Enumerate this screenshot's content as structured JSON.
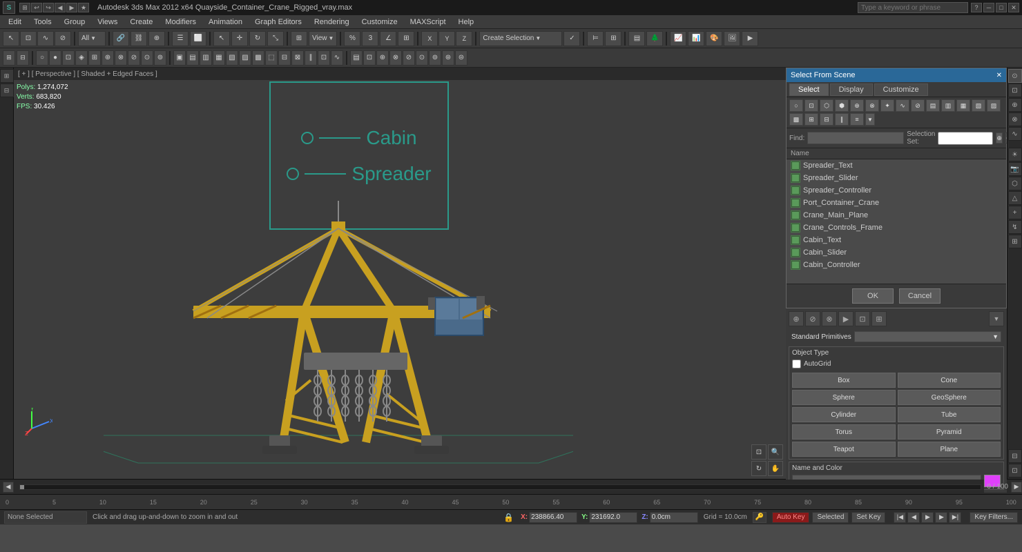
{
  "titlebar": {
    "title": "Autodesk 3ds Max 2012 x64     Quayside_Container_Crane_Rigged_vray.max",
    "search_placeholder": "Type a keyword or phrase"
  },
  "menubar": {
    "items": [
      "Edit",
      "Tools",
      "Group",
      "Views",
      "Create",
      "Modifiers",
      "Animation",
      "Graph Editors",
      "Rendering",
      "Customize",
      "MAXScript",
      "Help"
    ]
  },
  "viewport": {
    "header": "[ + ] [ Perspective ] [ Shaded + Edged Faces ]",
    "stats": {
      "polys_label": "Polys:",
      "polys_value": "1,274,072",
      "verts_label": "Verts:",
      "verts_value": "683,820",
      "fps_label": "FPS:",
      "fps_value": "30.426"
    },
    "cabin_text": "Cabin",
    "spreader_text": "Spreader"
  },
  "select_dialog": {
    "title": "Select From Scene",
    "tabs": [
      "Select",
      "Display",
      "Customize"
    ],
    "find_label": "Find:",
    "selection_set_label": "Selection Set:",
    "name_header": "Name",
    "objects": [
      "Spreader_Text",
      "Spreader_Slider",
      "Spreader_Controller",
      "Port_Container_Crane",
      "Crane_Main_Plane",
      "Crane_Controls_Frame",
      "Cabin_Text",
      "Cabin_Slider",
      "Cabin_Controller"
    ],
    "ok_label": "OK",
    "cancel_label": "Cancel"
  },
  "right_panel": {
    "standard_primitives_label": "Standard Primitives",
    "object_type_label": "Object Type",
    "autogrid_label": "AutoGrid",
    "object_types": [
      "Box",
      "Cone",
      "Sphere",
      "GeoSphere",
      "Cylinder",
      "Tube",
      "Torus",
      "Pyramid",
      "Teapot",
      "Plane"
    ],
    "name_and_color_label": "Name and Color"
  },
  "statusbar": {
    "selection_label": "None Selected",
    "message": "Click and drag up-and-down to zoom in and out",
    "x_label": "X:",
    "x_value": "238866.40",
    "y_label": "Y:",
    "y_value": "231692.0",
    "z_label": "Z:",
    "z_value": "0.0cm",
    "grid_label": "Grid = 10.0cm",
    "auto_key_label": "Auto Key",
    "selected_label": "Selected",
    "set_key_label": "Set Key",
    "key_filters_label": "Key Filters..."
  },
  "timeline": {
    "current_frame": "0",
    "total_frames": "100",
    "frame_markers": [
      "0",
      "5",
      "10",
      "15",
      "20",
      "25",
      "30",
      "35",
      "40",
      "45",
      "50",
      "55",
      "60",
      "65",
      "70",
      "75",
      "80",
      "85",
      "90",
      "95",
      "100"
    ]
  },
  "icons": {
    "close": "✕",
    "minimize": "─",
    "maximize": "□",
    "play": "▶",
    "stop": "■",
    "prev": "◀◀",
    "next": "▶▶",
    "prev_frame": "◀",
    "next_frame": "▶",
    "key": "🔑",
    "lock": "🔒"
  }
}
